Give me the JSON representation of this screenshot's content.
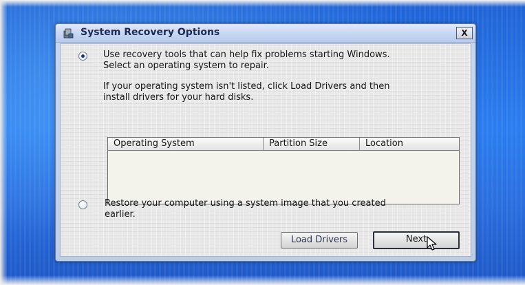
{
  "dialog": {
    "title": "System Recovery Options",
    "close_label": "X"
  },
  "option_repair": {
    "selected": true,
    "line1": "Use recovery tools that can help fix problems starting Windows.",
    "line2": "Select an operating system to repair."
  },
  "info": {
    "line1": "If your operating system isn't listed, click Load Drivers and then",
    "line2": "install drivers for your hard disks."
  },
  "os_list": {
    "columns": [
      "Operating System",
      "Partition Size",
      "Location"
    ],
    "rows": []
  },
  "option_restore": {
    "selected": false,
    "line1": "Restore your computer using a system image that you created",
    "line2": "earlier."
  },
  "buttons": {
    "load_drivers": "Load Drivers",
    "next": "Next"
  },
  "icons": {
    "title": "system-recovery-icon",
    "cursor": "mouse-pointer-icon"
  },
  "colors": {
    "desktop": "#2a7df0",
    "dialog_frame": "#c7d7f2",
    "title_text": "#1d2a55"
  }
}
